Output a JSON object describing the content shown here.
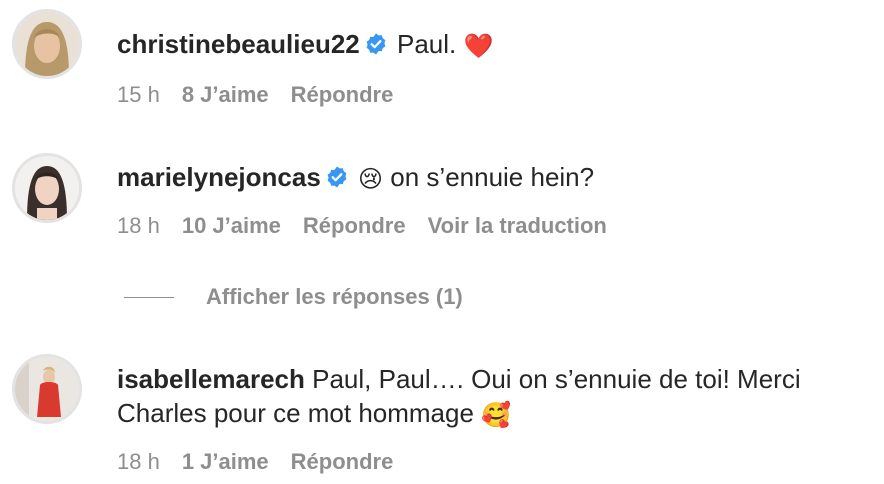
{
  "comments": [
    {
      "username": "christinebeaulieu22",
      "verified": true,
      "text": "Paul. ",
      "emoji": "❤️",
      "time": "15 h",
      "likes": "8 J’aime",
      "reply": "Répondre"
    },
    {
      "username": "marielynejoncas",
      "verified": true,
      "emoji": "😢",
      "text": " on s’ennuie hein?",
      "time": "18 h",
      "likes": "10 J’aime",
      "reply": "Répondre",
      "translate": "Voir la traduction",
      "view_replies": "Afficher les réponses (1)"
    },
    {
      "username": "isabellemarech",
      "verified": false,
      "text_line1": "Paul, Paul…. Oui on s’ennuie de toi! Merci",
      "text_line2": "Charles pour ce mot hommage ",
      "emoji": "🥰",
      "time": "18 h",
      "likes": "1 J’aime",
      "reply": "Répondre"
    }
  ],
  "colors": {
    "text": "#262626",
    "secondary": "#8e8e8e",
    "verified": "#3897f0"
  }
}
